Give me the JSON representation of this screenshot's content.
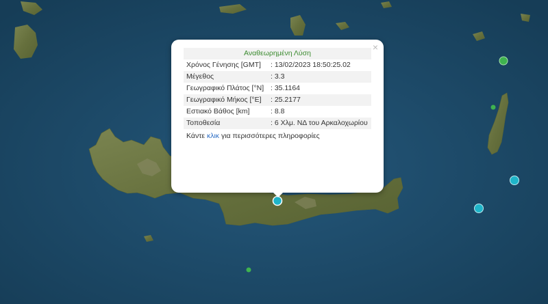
{
  "popup": {
    "title": "Αναθεωρημένη Λύση",
    "close_symbol": "×",
    "rows": [
      {
        "label": "Χρόνος Γένησης [GMT]",
        "value": ": 13/02/2023 18:50:25.02"
      },
      {
        "label": "Μέγεθος",
        "value": ": 3.3"
      },
      {
        "label": "Γεωγραφικό Πλάτος [°N]",
        "value": ": 35.1164"
      },
      {
        "label": "Γεωγραφικό Μήκος [°E]",
        "value": ": 25.2177"
      },
      {
        "label": "Εστιακό Βάθος [km]",
        "value": ": 8.8"
      },
      {
        "label": "Τοποθεσία",
        "value": ": 6 Χλμ. ΝΔ του Αρκαλοχωρίου"
      }
    ],
    "footer_prefix": "Κάντε ",
    "footer_link": "κλικ",
    "footer_suffix": " για περισσότερες πληροφορίες"
  },
  "colors": {
    "sea": "#1c4a66",
    "land": "#6f7a45",
    "popup_title": "#3a8a2e",
    "link": "#2a6cc4",
    "quake_recent": "#1fb5c9",
    "quake_older": "#3fb34f"
  },
  "icons": {
    "close": "close-icon",
    "marker": "earthquake-marker-icon"
  }
}
